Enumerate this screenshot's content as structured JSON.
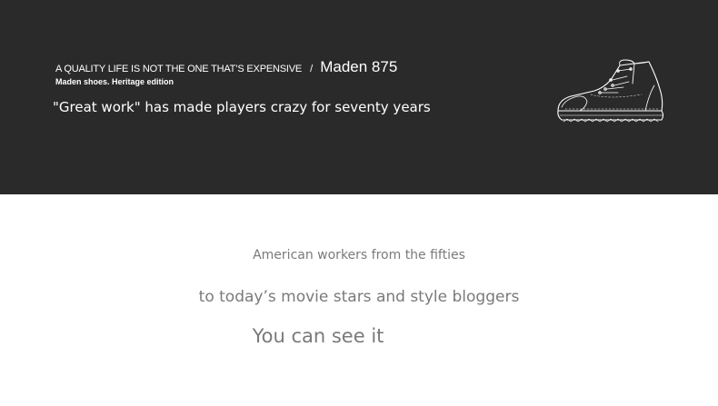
{
  "banner": {
    "tagline": "A QUALITY LIFE IS NOT THE ONE THAT’S EXPENSIVE",
    "separator": "/",
    "model": "Maden 875",
    "edition": "Maden shoes. Heritage edition",
    "quote": "\"Great work\" has made players crazy for seventy years",
    "boot_icon": "boot-sketch-icon"
  },
  "body": {
    "line1": "American workers from the fifties",
    "line2": "to today’s movie stars and style bloggers",
    "line3": "You can see it"
  },
  "colors": {
    "banner_bg": "#2b2a2a",
    "banner_text": "#ffffff",
    "body_text": "#7a7a7a"
  }
}
